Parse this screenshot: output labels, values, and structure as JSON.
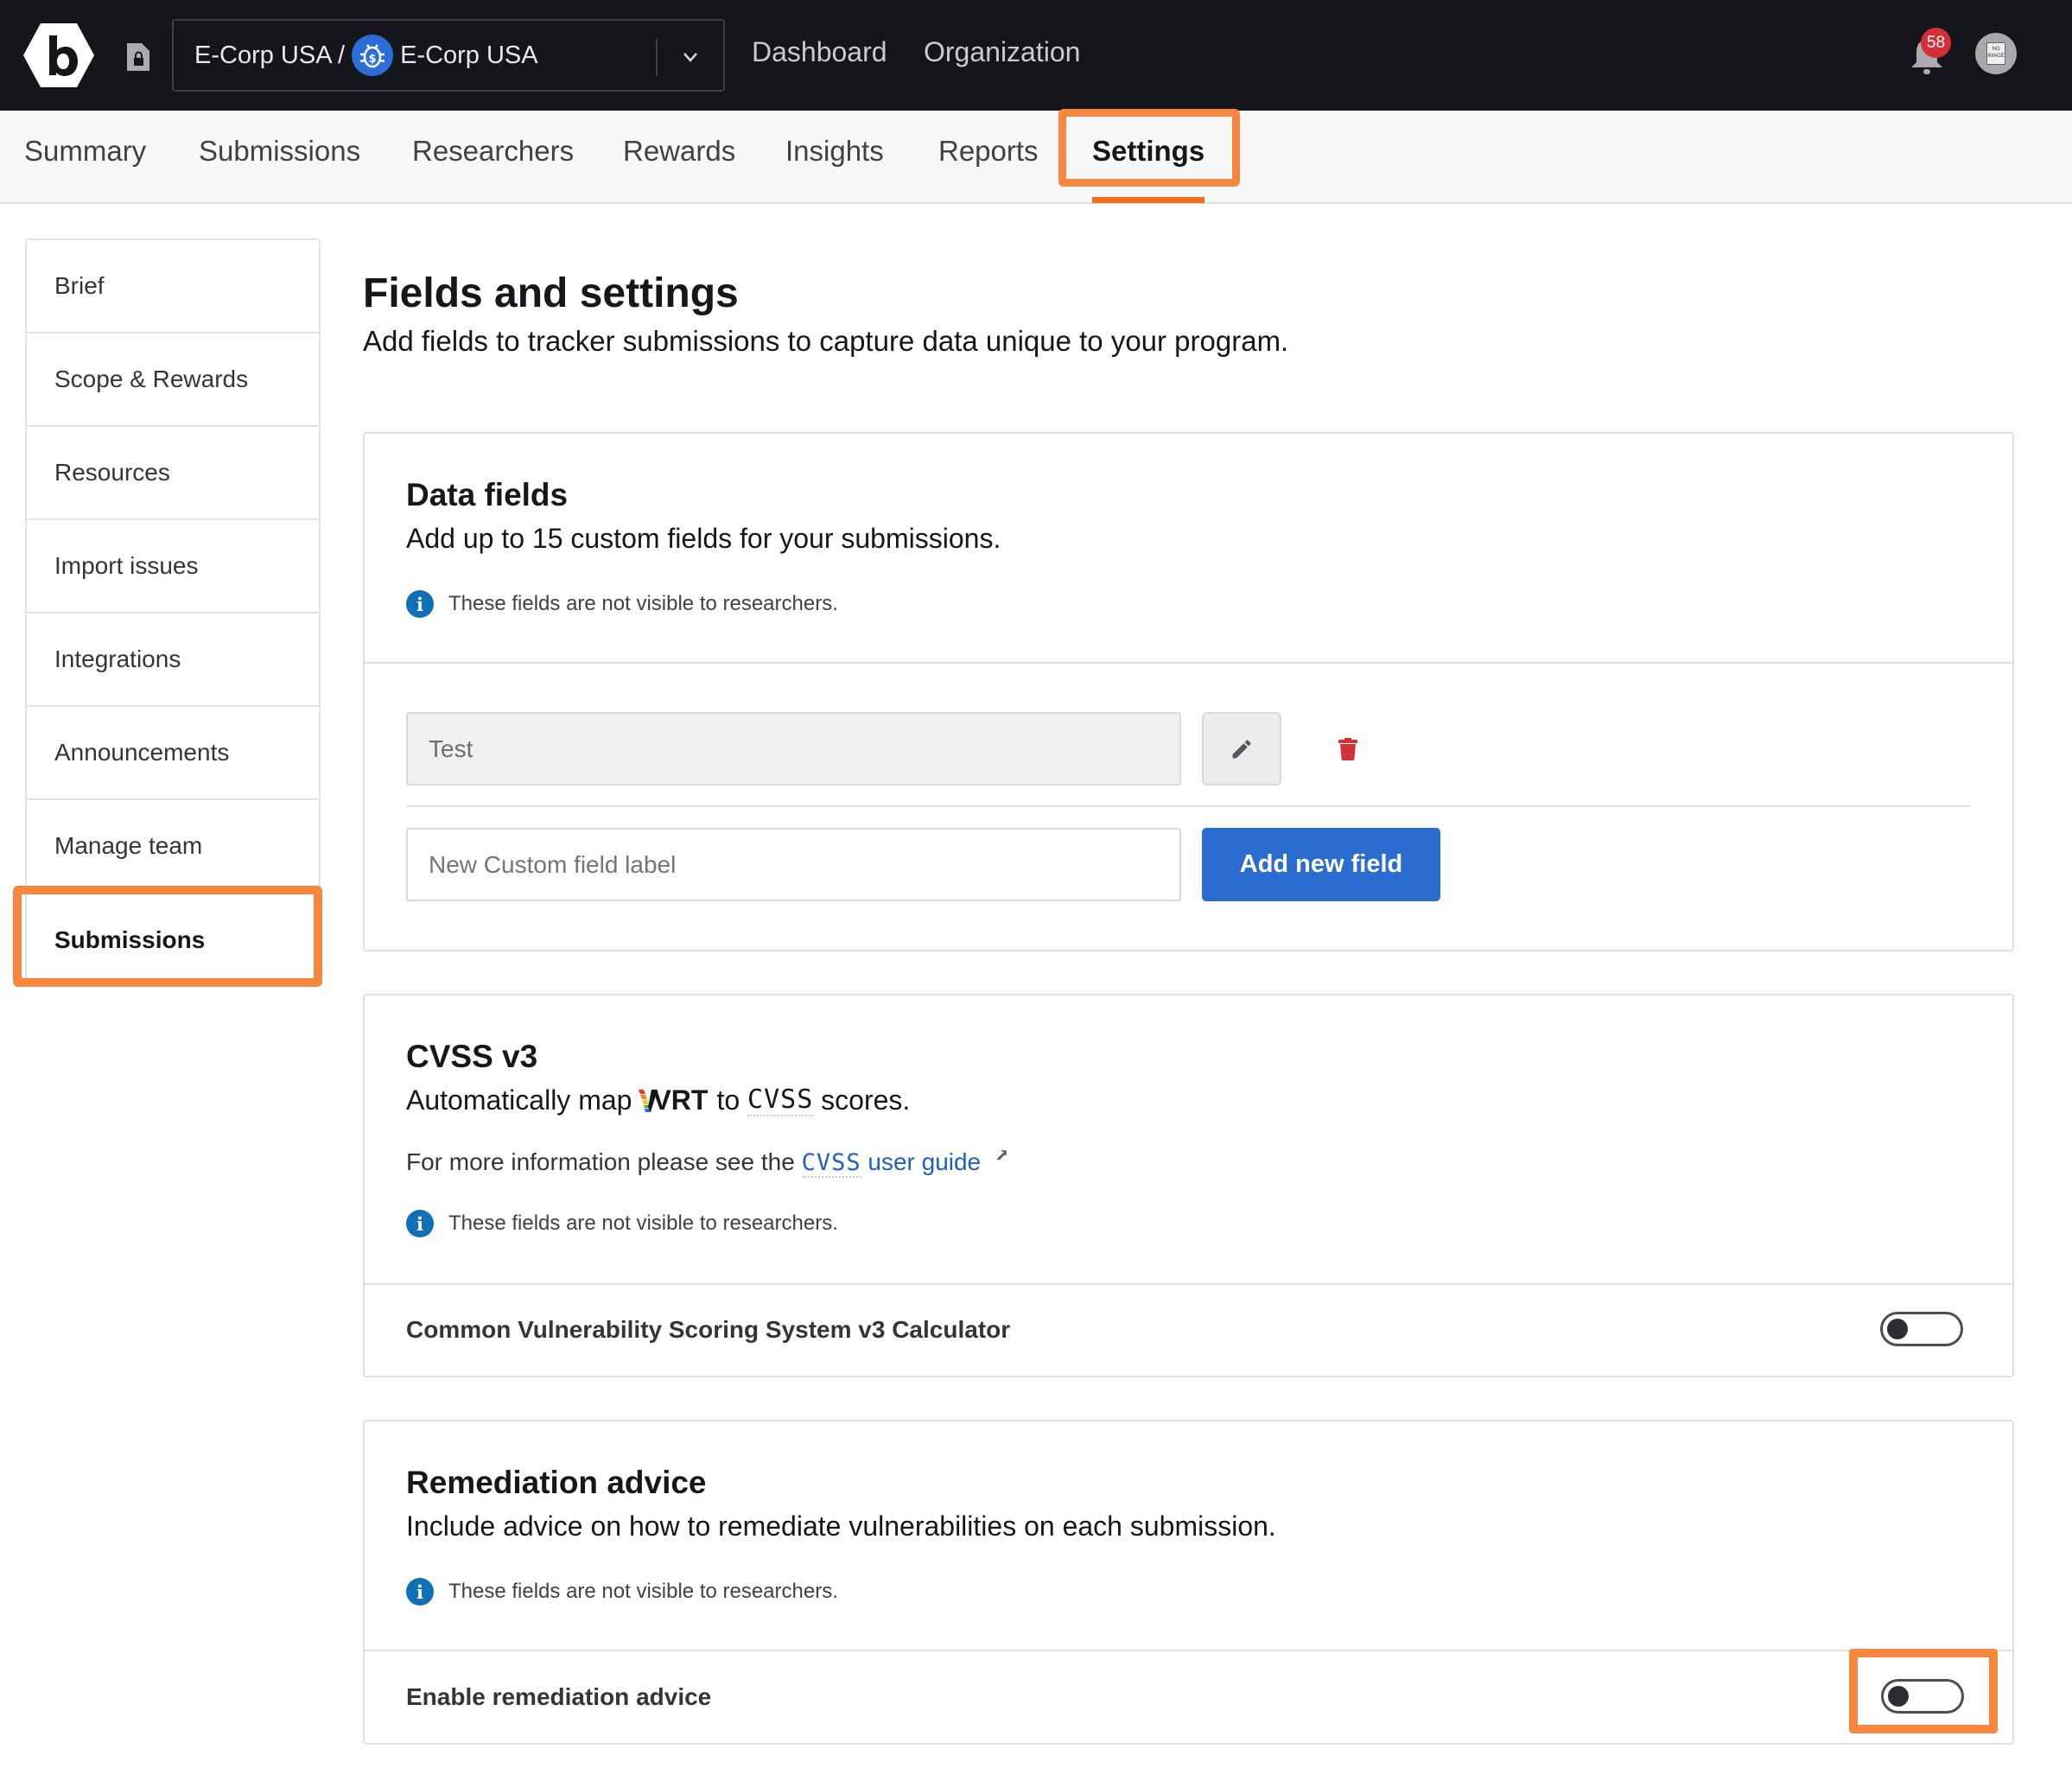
{
  "header": {
    "org_name": "E-Corp USA /",
    "program_name": "E-Corp USA",
    "nav": [
      "Dashboard",
      "Organization"
    ],
    "notification_count": "58",
    "avatar_text": "NO IMAGE"
  },
  "tabs": [
    {
      "label": "Summary",
      "active": false
    },
    {
      "label": "Submissions",
      "active": false
    },
    {
      "label": "Researchers",
      "active": false
    },
    {
      "label": "Rewards",
      "active": false
    },
    {
      "label": "Insights",
      "active": false
    },
    {
      "label": "Reports",
      "active": false
    },
    {
      "label": "Settings",
      "active": true
    }
  ],
  "sidebar": {
    "items": [
      {
        "label": "Brief"
      },
      {
        "label": "Scope & Rewards"
      },
      {
        "label": "Resources"
      },
      {
        "label": "Import issues"
      },
      {
        "label": "Integrations"
      },
      {
        "label": "Announcements"
      },
      {
        "label": "Manage team"
      },
      {
        "label": "Submissions",
        "active": true
      }
    ]
  },
  "main": {
    "title": "Fields and settings",
    "subtitle": "Add fields to tracker submissions to capture data unique to your program.",
    "data_fields": {
      "title": "Data fields",
      "description": "Add up to 15 custom fields for your submissions.",
      "info": "These fields are not visible to researchers.",
      "existing_field_value": "Test",
      "new_field_placeholder": "New Custom field label",
      "add_button": "Add new field"
    },
    "cvss": {
      "title": "CVSS v3",
      "desc_prefix": "Automatically map",
      "vrt_logo": "VRT",
      "desc_to": "to",
      "desc_cvss": "CVSS",
      "desc_suffix": "scores.",
      "more_info_prefix": "For more information please see the",
      "guide_link_cvss": "CVSS",
      "guide_link_rest": "user guide",
      "info": "These fields are not visible to researchers.",
      "toggle_label": "Common Vulnerability Scoring System v3 Calculator",
      "toggle_on": false
    },
    "remediation": {
      "title": "Remediation advice",
      "description": "Include advice on how to remediate vulnerabilities on each submission.",
      "info": "These fields are not visible to researchers.",
      "toggle_label": "Enable remediation advice",
      "toggle_on": false
    }
  },
  "colors": {
    "header_bg": "#15161b",
    "accent_blue": "#2b6cd0",
    "highlight_orange": "#f7873f",
    "tab_underline": "#f56c1b",
    "badge_red": "#d32f34",
    "info_blue": "#0f70b7",
    "trash_red": "#d13438"
  }
}
